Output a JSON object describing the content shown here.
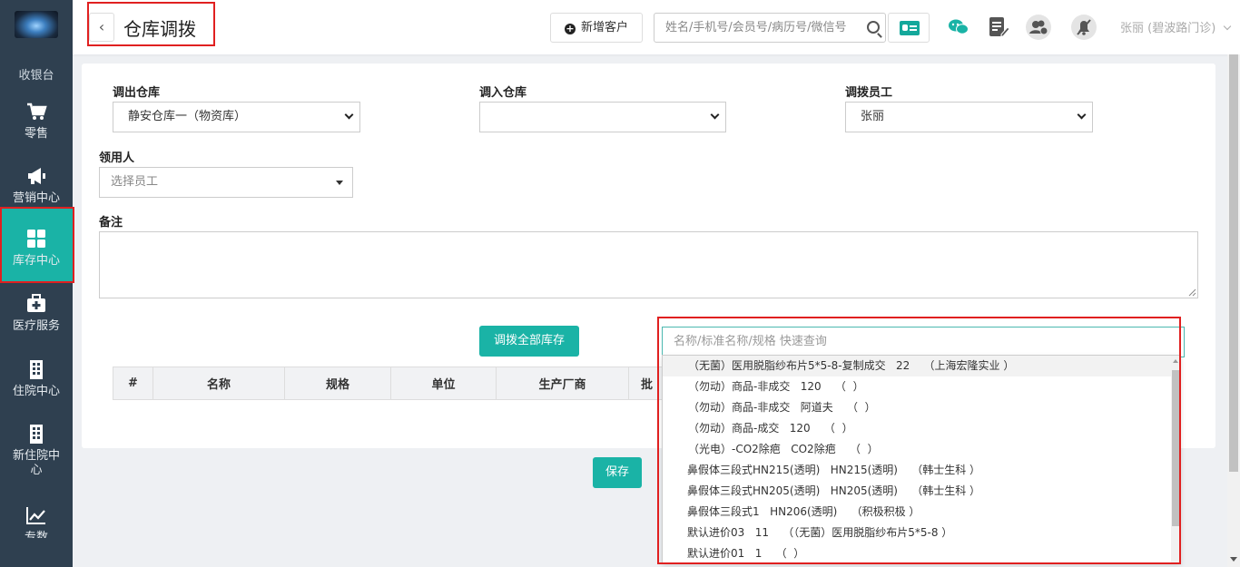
{
  "sidebar": {
    "top_cut_label": "收银台",
    "items": [
      {
        "label": "零售",
        "icon": "cart-icon"
      },
      {
        "label": "营销中心",
        "icon": "megaphone-icon"
      },
      {
        "label": "库存中心",
        "icon": "grid-icon"
      },
      {
        "label": "医疗服务",
        "icon": "medical-kit-icon"
      },
      {
        "label": "住院中心",
        "icon": "hospital-icon"
      },
      {
        "label": "新住院中心",
        "icon": "hospital-icon"
      },
      {
        "label": "专数",
        "icon": "trend-chart-icon"
      }
    ],
    "active_color": "#1ab3a6"
  },
  "header": {
    "title": "仓库调拨",
    "back_label": "‹",
    "new_customer_label": "新增客户",
    "search_placeholder": "姓名/手机号/会员号/病历号/微信号",
    "user": "张丽 (碧波路门诊)"
  },
  "form": {
    "out_warehouse": {
      "label": "调出仓库",
      "value": "静安仓库一（物资库）"
    },
    "in_warehouse": {
      "label": "调入仓库",
      "value": ""
    },
    "staff": {
      "label": "调拨员工",
      "value": "张丽"
    },
    "receiver": {
      "label": "领用人",
      "placeholder": "选择员工"
    },
    "remark": {
      "label": "备注",
      "value": ""
    },
    "transfer_all_label": "调拨全部库存",
    "save_label": "保存"
  },
  "table": {
    "columns": [
      "#",
      "名称",
      "规格",
      "单位",
      "生产厂商",
      "批"
    ]
  },
  "dropdown": {
    "placeholder": "名称/标准名称/规格 快速查询",
    "options": [
      "（无菌）医用脱脂纱布片5*5-8-复制成交   22    （上海宏隆实业 ）",
      "（勿动）商品-非成交   120    （  ）",
      "（勿动）商品-非成交   阿道夫    （  ）",
      "（勿动）商品-成交   120    （  ）",
      "（光电）-CO2除疤   CO2除疤    （  ）",
      "鼻假体三段式HN215(透明)   HN215(透明)    （韩士生科 ）",
      "鼻假体三段式HN205(透明)   HN205(透明)    （韩士生科 ）",
      "鼻假体三段式1   HN206(透明)    （积极积极 ）",
      "默认进价03   11    （（无菌）医用脱脂纱布片5*5-8 ）",
      "默认进价01   1    （  ）"
    ]
  },
  "colors": {
    "accent": "#1ab3a6",
    "sidebar_bg": "#2f4050",
    "highlight_box": "#e02020"
  }
}
